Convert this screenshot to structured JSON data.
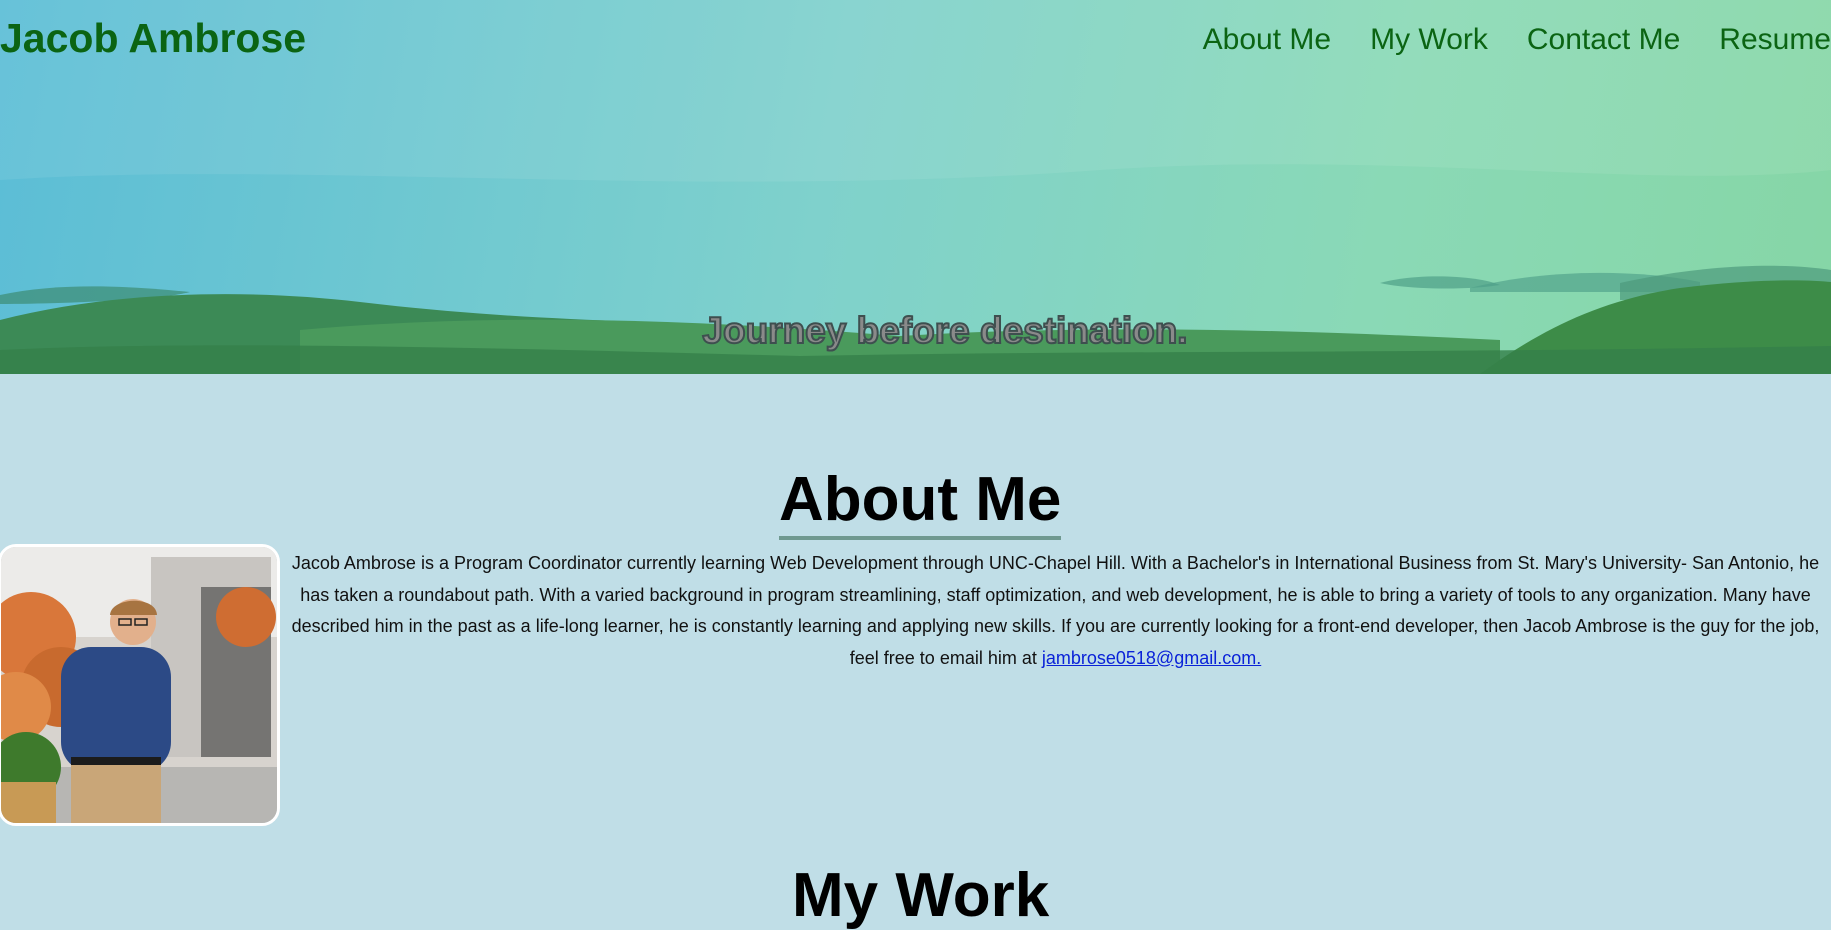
{
  "header": {
    "brand": "Jacob Ambrose",
    "nav": [
      "About Me",
      "My Work",
      "Contact Me",
      "Resume"
    ],
    "motto": "Journey before destination."
  },
  "about": {
    "title": "About Me",
    "bio": "Jacob Ambrose is a Program Coordinator currently learning Web Development through UNC-Chapel Hill. With a Bachelor's in International Business from St. Mary's University- San Antonio, he has taken a roundabout path. With a varied background in program streamlining, staff optimization, and web development, he is able to bring a variety of tools to any organization. Many have described him in the past as a life-long learner, he is constantly learning and applying new skills. If you are currently looking for a front-end developer, then Jacob Ambrose is the guy for the job, feel free to email him at ",
    "email": "jambrose0518@gmail.com."
  },
  "work": {
    "title": "My Work"
  },
  "colors": {
    "background": "#c0dee7",
    "brand_green": "#0b6413",
    "link_blue": "#0a22d8",
    "underline": "#6f9990"
  }
}
